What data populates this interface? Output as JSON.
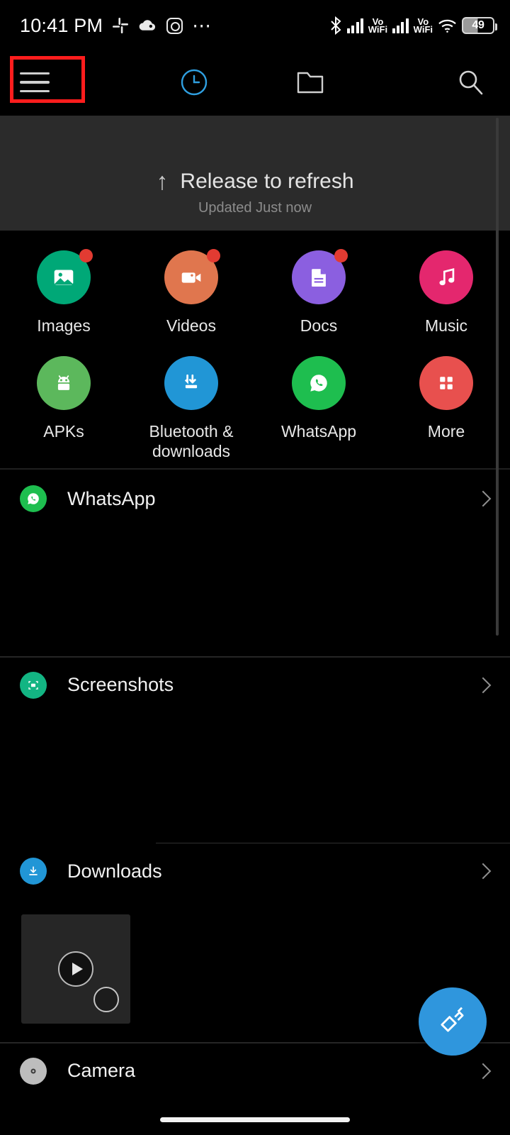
{
  "statusbar": {
    "time": "10:41 PM",
    "left_icons": [
      "slack-icon",
      "cloud-icon",
      "instagram-icon",
      "overflow-dots-icon"
    ],
    "right_icons": [
      "bluetooth-icon",
      "signal-bars-icon",
      "wifi-icon",
      "battery-icon"
    ],
    "volte1_line1": "Vo",
    "volte1_line2": "WiFi",
    "volte2_line1": "Vo",
    "volte2_line2": "WiFi",
    "battery_level": "49"
  },
  "toolbar": {
    "menu_icon": "hamburger-menu-icon",
    "recent_icon": "clock-recent-icon",
    "folders_icon": "folder-icon",
    "search_icon": "search-icon",
    "active_tab": "recent",
    "highlight_color": "#ff1d1d",
    "active_color": "#2f9fe0"
  },
  "refresh": {
    "arrow": "↑",
    "text": "Release to refresh",
    "subtext": "Updated Just now"
  },
  "categories": [
    {
      "label": "Images",
      "icon": "image-icon",
      "color": "#00a877",
      "badge": true
    },
    {
      "label": "Videos",
      "icon": "video-camera-icon",
      "color": "#e0764e",
      "badge": true
    },
    {
      "label": "Docs",
      "icon": "document-icon",
      "color": "#8b5fe0",
      "badge": true
    },
    {
      "label": "Music",
      "icon": "music-note-icon",
      "color": "#e4276e",
      "badge": false
    },
    {
      "label": "APKs",
      "icon": "android-robot-icon",
      "color": "#5cb85c",
      "badge": false
    },
    {
      "label": "Bluetooth & downloads",
      "icon": "bluetooth-download-icon",
      "color": "#2196d6",
      "badge": false
    },
    {
      "label": "WhatsApp",
      "icon": "whatsapp-icon",
      "color": "#1ebe4f",
      "badge": false
    },
    {
      "label": "More",
      "icon": "grid-more-icon",
      "color": "#e8504e",
      "badge": false
    }
  ],
  "file_sections": [
    {
      "title": "WhatsApp",
      "icon": "whatsapp-icon",
      "color": "#1ebe4f",
      "chevron": "chevron-right-icon"
    },
    {
      "title": "Screenshots",
      "icon": "screenshot-icon",
      "color": "#13b583",
      "chevron": "chevron-right-icon"
    },
    {
      "title": "Downloads",
      "icon": "download-icon",
      "color": "#2196d6",
      "chevron": "chevron-right-icon"
    },
    {
      "title": "Camera",
      "icon": "camera-icon",
      "color": "#bdbdbd",
      "chevron": "chevron-right-icon"
    }
  ],
  "thumbnail": {
    "type": "video",
    "play_icon": "play-icon",
    "select_icon": "selection-circle-icon",
    "selected": false
  },
  "fab": {
    "icon": "clean-brush-icon",
    "color": "#2f96dd"
  },
  "scrollbar": {
    "name": "vertical-scrollbar"
  },
  "home_indicator": {
    "name": "home-gesture-bar"
  }
}
